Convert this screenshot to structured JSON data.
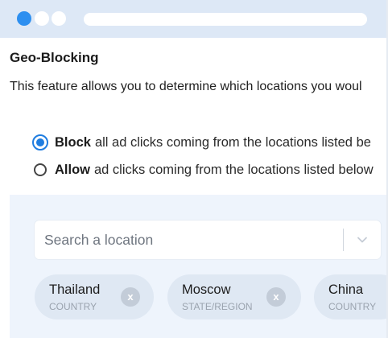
{
  "window": {
    "accent_color": "#2d8ff0"
  },
  "section": {
    "title": "Geo-Blocking",
    "description": "This feature allows you to determine which locations you woul"
  },
  "mode_options": [
    {
      "bold": "Block",
      "text": "all ad clicks coming from the locations listed be",
      "selected": true
    },
    {
      "bold": "Allow",
      "text": "ad clicks coming from the locations listed below",
      "selected": false
    }
  ],
  "search": {
    "placeholder": "Search a location"
  },
  "locations": [
    {
      "name": "Thailand",
      "type": "COUNTRY",
      "remove_label": "x"
    },
    {
      "name": "Moscow",
      "type": "STATE/REGION",
      "remove_label": "x"
    },
    {
      "name": "China",
      "type": "COUNTRY"
    }
  ]
}
